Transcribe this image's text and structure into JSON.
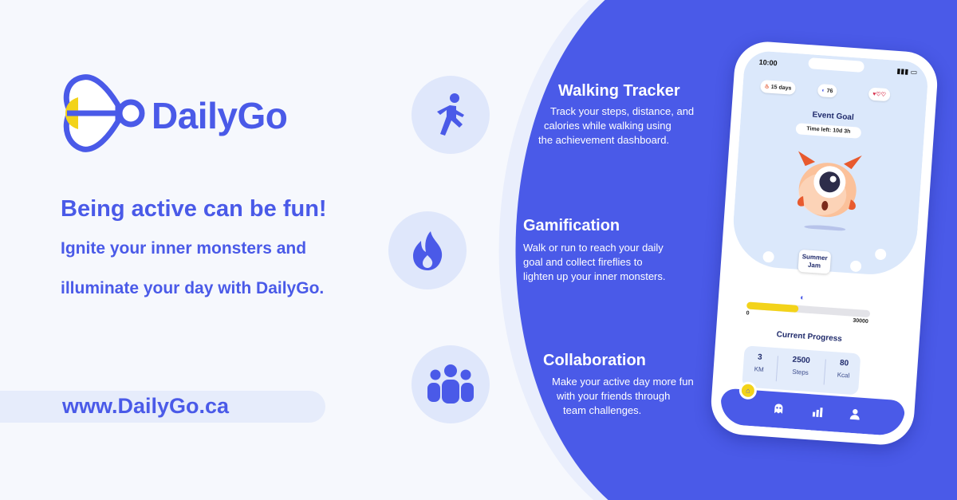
{
  "brand": {
    "name": "DailyGo",
    "colors": {
      "primary": "#4a5ae8",
      "accent": "#f3d31a",
      "light": "#dfe7fb",
      "background": "#f6f8fd"
    }
  },
  "hero": {
    "headline": "Being active can be fun!",
    "subline_1": "Ignite your inner monsters and",
    "subline_2": "illuminate your day with DailyGo.",
    "url": "www.DailyGo.ca"
  },
  "features": [
    {
      "icon": "walking-person-icon",
      "title": "Walking Tracker",
      "lines": [
        "Track your steps, distance, and",
        "calories while walking using",
        "the achievement dashboard."
      ]
    },
    {
      "icon": "flame-icon",
      "title": "Gamification",
      "lines": [
        "Walk or run to reach your daily",
        "goal and collect fireflies to",
        "lighten up your inner monsters."
      ]
    },
    {
      "icon": "team-icon",
      "title": "Collaboration",
      "lines": [
        "Make your active day more fun",
        "with your friends through",
        "team challenges."
      ]
    }
  ],
  "phone": {
    "status_time": "10:00",
    "chips": {
      "streak": "15 days",
      "fireflies": "76",
      "hearts": "♥♡♡"
    },
    "event_goal": "Event Goal",
    "time_left": "Time left: 10d 3h",
    "season_line1": "Summer",
    "season_line2": "Jam",
    "progress": {
      "min_label": "0",
      "max_label": "30000",
      "fraction": 0.42
    },
    "current_progress_label": "Current Progress",
    "stats": [
      {
        "value": "3",
        "label": "KM"
      },
      {
        "value": "2500",
        "label": "Steps"
      },
      {
        "value": "80",
        "label": "Kcal"
      }
    ],
    "nav_icons": [
      "home-icon",
      "monster-icon",
      "chart-icon",
      "profile-icon"
    ]
  }
}
